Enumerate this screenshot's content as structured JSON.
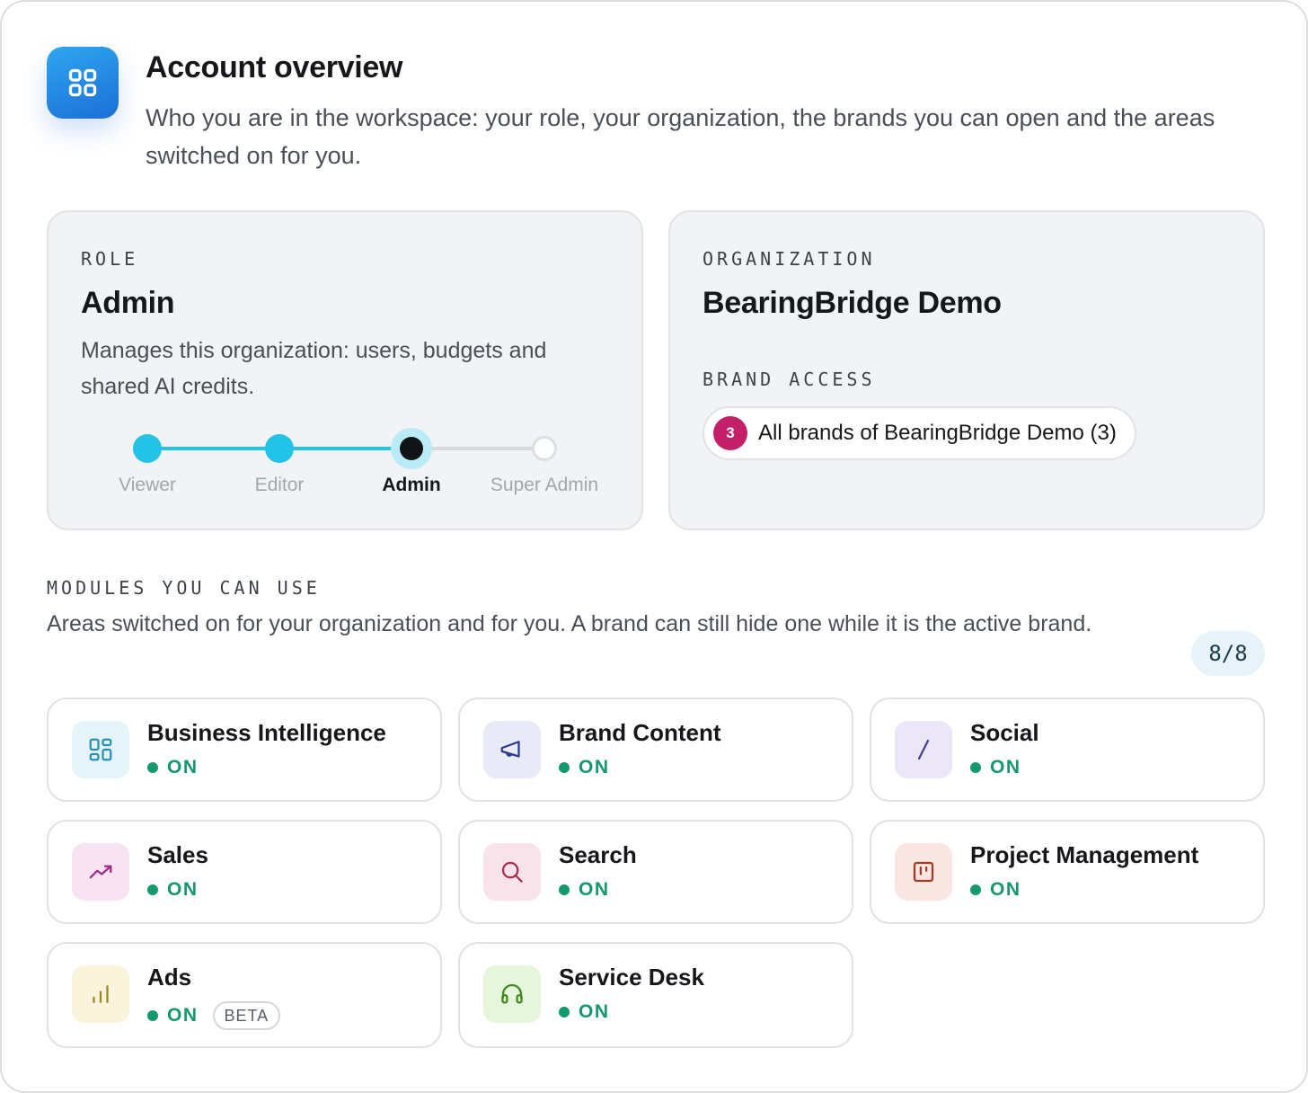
{
  "header": {
    "title": "Account overview",
    "subtitle": "Who you are in the workspace: your role, your organization, the brands you can open and the areas switched on for you.",
    "icon": "grid-icon",
    "icon_color": "#1f82e2"
  },
  "role": {
    "eyebrow": "ROLE",
    "name": "Admin",
    "description": "Manages this organization: users, budgets and shared AI credits.",
    "steps": [
      "Viewer",
      "Editor",
      "Admin",
      "Super Admin"
    ],
    "current_step": "Admin",
    "accent_color": "#22c3e6"
  },
  "organization": {
    "eyebrow": "ORGANIZATION",
    "name": "BearingBridge Demo",
    "brand_access_eyebrow": "BRAND ACCESS",
    "brand_count": "3",
    "brand_access_label": "All brands of BearingBridge Demo (3)",
    "badge_color": "#c4206a"
  },
  "modules_section": {
    "eyebrow": "MODULES YOU CAN USE",
    "description": "Areas switched on for your organization and for you. A brand can still hide one while it is the active brand.",
    "count": "8/8"
  },
  "modules": [
    {
      "name": "Business Intelligence",
      "status": "ON",
      "icon": "dashboard-icon"
    },
    {
      "name": "Brand Content",
      "status": "ON",
      "icon": "megaphone-icon"
    },
    {
      "name": "Social",
      "status": "ON",
      "icon": "slash-icon"
    },
    {
      "name": "Sales",
      "status": "ON",
      "icon": "trending-up-icon"
    },
    {
      "name": "Search",
      "status": "ON",
      "icon": "search-icon"
    },
    {
      "name": "Project Management",
      "status": "ON",
      "icon": "kanban-icon"
    },
    {
      "name": "Ads",
      "status": "ON",
      "tag": "BETA",
      "icon": "bar-chart-icon"
    },
    {
      "name": "Service Desk",
      "status": "ON",
      "icon": "headset-icon"
    }
  ],
  "status_color": "#14996b"
}
